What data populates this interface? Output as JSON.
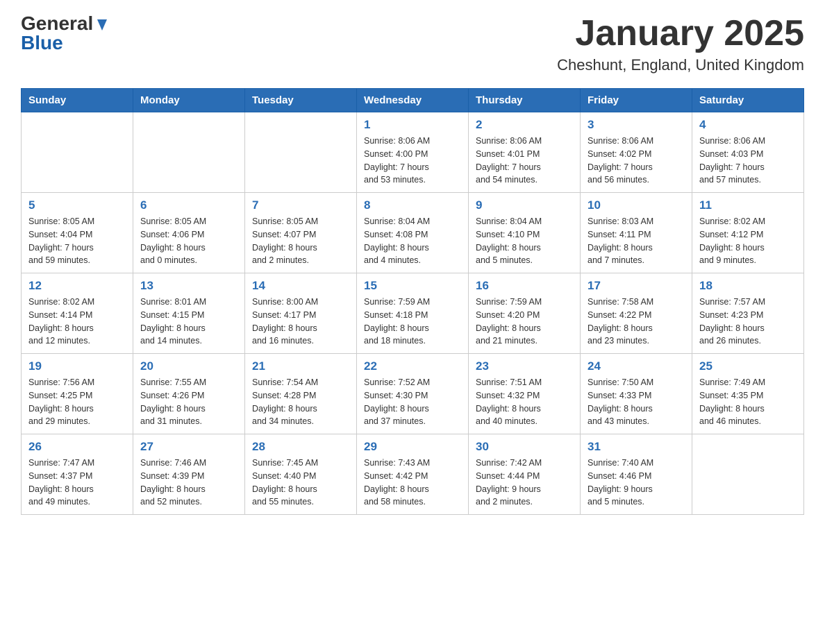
{
  "header": {
    "logo_general": "General",
    "logo_blue": "Blue",
    "title": "January 2025",
    "subtitle": "Cheshunt, England, United Kingdom"
  },
  "calendar": {
    "days_of_week": [
      "Sunday",
      "Monday",
      "Tuesday",
      "Wednesday",
      "Thursday",
      "Friday",
      "Saturday"
    ],
    "weeks": [
      [
        {
          "day": "",
          "info": ""
        },
        {
          "day": "",
          "info": ""
        },
        {
          "day": "",
          "info": ""
        },
        {
          "day": "1",
          "info": "Sunrise: 8:06 AM\nSunset: 4:00 PM\nDaylight: 7 hours\nand 53 minutes."
        },
        {
          "day": "2",
          "info": "Sunrise: 8:06 AM\nSunset: 4:01 PM\nDaylight: 7 hours\nand 54 minutes."
        },
        {
          "day": "3",
          "info": "Sunrise: 8:06 AM\nSunset: 4:02 PM\nDaylight: 7 hours\nand 56 minutes."
        },
        {
          "day": "4",
          "info": "Sunrise: 8:06 AM\nSunset: 4:03 PM\nDaylight: 7 hours\nand 57 minutes."
        }
      ],
      [
        {
          "day": "5",
          "info": "Sunrise: 8:05 AM\nSunset: 4:04 PM\nDaylight: 7 hours\nand 59 minutes."
        },
        {
          "day": "6",
          "info": "Sunrise: 8:05 AM\nSunset: 4:06 PM\nDaylight: 8 hours\nand 0 minutes."
        },
        {
          "day": "7",
          "info": "Sunrise: 8:05 AM\nSunset: 4:07 PM\nDaylight: 8 hours\nand 2 minutes."
        },
        {
          "day": "8",
          "info": "Sunrise: 8:04 AM\nSunset: 4:08 PM\nDaylight: 8 hours\nand 4 minutes."
        },
        {
          "day": "9",
          "info": "Sunrise: 8:04 AM\nSunset: 4:10 PM\nDaylight: 8 hours\nand 5 minutes."
        },
        {
          "day": "10",
          "info": "Sunrise: 8:03 AM\nSunset: 4:11 PM\nDaylight: 8 hours\nand 7 minutes."
        },
        {
          "day": "11",
          "info": "Sunrise: 8:02 AM\nSunset: 4:12 PM\nDaylight: 8 hours\nand 9 minutes."
        }
      ],
      [
        {
          "day": "12",
          "info": "Sunrise: 8:02 AM\nSunset: 4:14 PM\nDaylight: 8 hours\nand 12 minutes."
        },
        {
          "day": "13",
          "info": "Sunrise: 8:01 AM\nSunset: 4:15 PM\nDaylight: 8 hours\nand 14 minutes."
        },
        {
          "day": "14",
          "info": "Sunrise: 8:00 AM\nSunset: 4:17 PM\nDaylight: 8 hours\nand 16 minutes."
        },
        {
          "day": "15",
          "info": "Sunrise: 7:59 AM\nSunset: 4:18 PM\nDaylight: 8 hours\nand 18 minutes."
        },
        {
          "day": "16",
          "info": "Sunrise: 7:59 AM\nSunset: 4:20 PM\nDaylight: 8 hours\nand 21 minutes."
        },
        {
          "day": "17",
          "info": "Sunrise: 7:58 AM\nSunset: 4:22 PM\nDaylight: 8 hours\nand 23 minutes."
        },
        {
          "day": "18",
          "info": "Sunrise: 7:57 AM\nSunset: 4:23 PM\nDaylight: 8 hours\nand 26 minutes."
        }
      ],
      [
        {
          "day": "19",
          "info": "Sunrise: 7:56 AM\nSunset: 4:25 PM\nDaylight: 8 hours\nand 29 minutes."
        },
        {
          "day": "20",
          "info": "Sunrise: 7:55 AM\nSunset: 4:26 PM\nDaylight: 8 hours\nand 31 minutes."
        },
        {
          "day": "21",
          "info": "Sunrise: 7:54 AM\nSunset: 4:28 PM\nDaylight: 8 hours\nand 34 minutes."
        },
        {
          "day": "22",
          "info": "Sunrise: 7:52 AM\nSunset: 4:30 PM\nDaylight: 8 hours\nand 37 minutes."
        },
        {
          "day": "23",
          "info": "Sunrise: 7:51 AM\nSunset: 4:32 PM\nDaylight: 8 hours\nand 40 minutes."
        },
        {
          "day": "24",
          "info": "Sunrise: 7:50 AM\nSunset: 4:33 PM\nDaylight: 8 hours\nand 43 minutes."
        },
        {
          "day": "25",
          "info": "Sunrise: 7:49 AM\nSunset: 4:35 PM\nDaylight: 8 hours\nand 46 minutes."
        }
      ],
      [
        {
          "day": "26",
          "info": "Sunrise: 7:47 AM\nSunset: 4:37 PM\nDaylight: 8 hours\nand 49 minutes."
        },
        {
          "day": "27",
          "info": "Sunrise: 7:46 AM\nSunset: 4:39 PM\nDaylight: 8 hours\nand 52 minutes."
        },
        {
          "day": "28",
          "info": "Sunrise: 7:45 AM\nSunset: 4:40 PM\nDaylight: 8 hours\nand 55 minutes."
        },
        {
          "day": "29",
          "info": "Sunrise: 7:43 AM\nSunset: 4:42 PM\nDaylight: 8 hours\nand 58 minutes."
        },
        {
          "day": "30",
          "info": "Sunrise: 7:42 AM\nSunset: 4:44 PM\nDaylight: 9 hours\nand 2 minutes."
        },
        {
          "day": "31",
          "info": "Sunrise: 7:40 AM\nSunset: 4:46 PM\nDaylight: 9 hours\nand 5 minutes."
        },
        {
          "day": "",
          "info": ""
        }
      ]
    ]
  }
}
